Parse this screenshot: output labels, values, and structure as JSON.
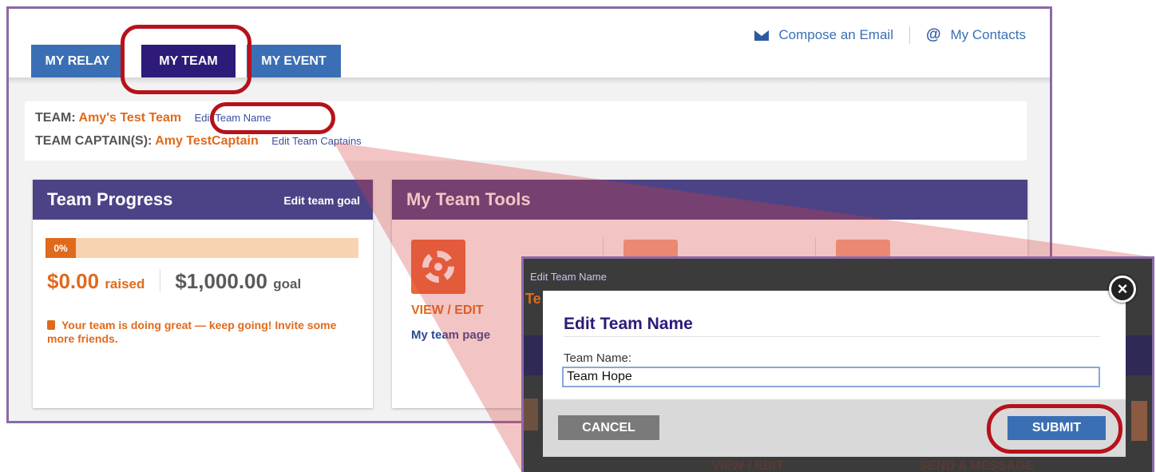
{
  "tabs": [
    "MY RELAY",
    "MY TEAM",
    "MY EVENT"
  ],
  "toplinks": {
    "compose": "Compose an Email",
    "contacts": "My Contacts",
    "at_symbol": "@"
  },
  "team": {
    "team_label": "TEAM:",
    "team_name": "Amy's Test Team",
    "edit_name": "Edit Team Name",
    "captain_label": "TEAM CAPTAIN(S):",
    "captain_name": "Amy TestCaptain",
    "edit_captains": "Edit Team Captains"
  },
  "progress": {
    "title": "Team Progress",
    "edit_goal": "Edit team goal",
    "percent_label": "0%",
    "percent_value": 0,
    "raised": "$0.00",
    "raised_suffix": "raised",
    "goal": "$1,000.00",
    "goal_suffix": "goal",
    "message": "Your team is doing great — keep going! Invite some more friends."
  },
  "tools": {
    "title": "My Team Tools",
    "view_edit": "VIEW / EDIT",
    "team_page": "My team page"
  },
  "zoom": {
    "bg_edit_team_name": "Edit Team Name",
    "bg_te": "Te",
    "bg_view_edit": "VIEW / EDIT",
    "bg_send_message": "SEND A MESSAGE",
    "bg_ta": "TA"
  },
  "modal": {
    "title": "Edit Team Name",
    "field_label": "Team Name:",
    "field_value": "Team Hope",
    "cancel": "CANCEL",
    "submit": "SUBMIT",
    "close_symbol": "×"
  },
  "colors": {
    "accent_purple": "#4c4387",
    "tab_blue": "#3a6fb5",
    "active_tab": "#2e1a78",
    "orange": "#e06a1c",
    "highlight_red": "#b5121b"
  },
  "icons": [
    "envelope-icon",
    "at-icon",
    "thumbs-up-icon",
    "gear-icon",
    "close-icon"
  ]
}
